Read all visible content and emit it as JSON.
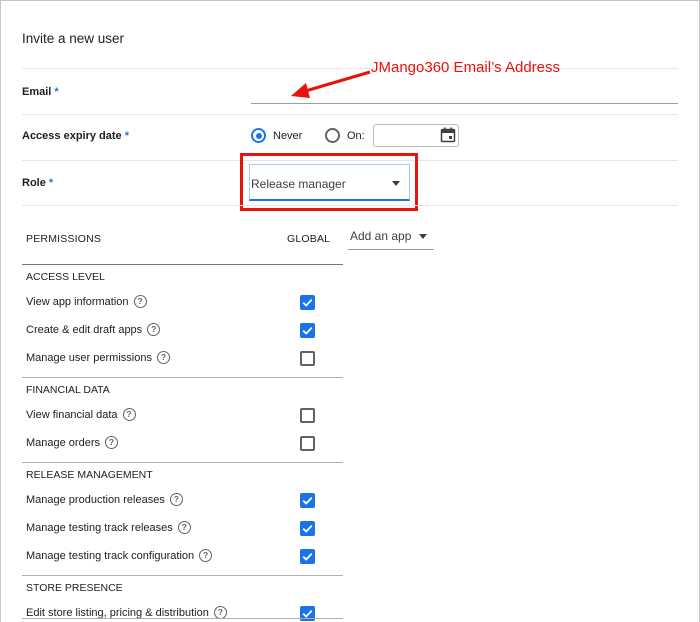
{
  "dialog": {
    "title": "Invite a new user"
  },
  "annotation": {
    "text": "JMango360 Email’s Address",
    "color": "#e8130b"
  },
  "form": {
    "email_label": "Email",
    "access_label": "Access expiry date",
    "role_label": "Role",
    "required_mark": "*",
    "expiry_never": "Never",
    "expiry_on": "On:",
    "selected_expiry": "Never",
    "role_value": "Release manager"
  },
  "permissions": {
    "header_permissions": "PERMISSIONS",
    "header_global": "GLOBAL",
    "add_app": "Add an app",
    "sections": [
      {
        "title": "ACCESS LEVEL",
        "items": [
          {
            "label": "View app information",
            "checked": true
          },
          {
            "label": "Create & edit draft apps",
            "checked": true
          },
          {
            "label": "Manage user permissions",
            "checked": false
          }
        ]
      },
      {
        "title": "FINANCIAL DATA",
        "items": [
          {
            "label": "View financial data",
            "checked": false
          },
          {
            "label": "Manage orders",
            "checked": false
          }
        ]
      },
      {
        "title": "RELEASE MANAGEMENT",
        "items": [
          {
            "label": "Manage production releases",
            "checked": true
          },
          {
            "label": "Manage testing track releases",
            "checked": true
          },
          {
            "label": "Manage testing track configuration",
            "checked": true
          }
        ]
      },
      {
        "title": "STORE PRESENCE",
        "items": [
          {
            "label": "Edit store listing, pricing & distribution",
            "checked": true
          }
        ]
      }
    ]
  },
  "help_glyph": "?",
  "colors": {
    "accent": "#1a73e8",
    "annotation_red": "#e8130b"
  }
}
